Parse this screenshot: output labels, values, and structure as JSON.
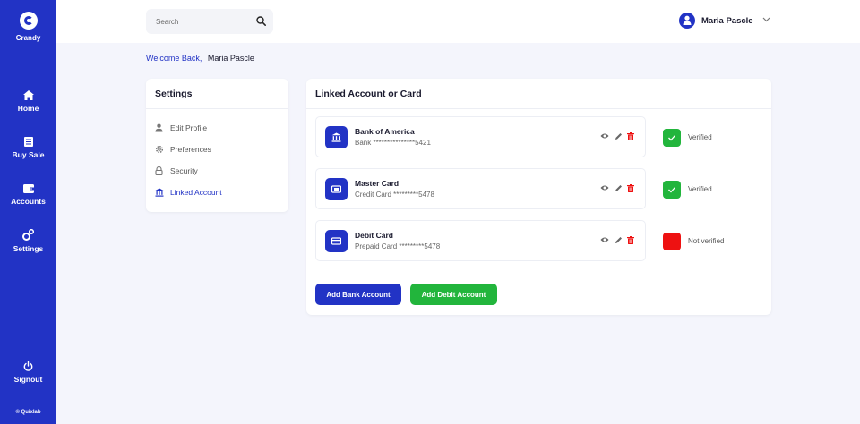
{
  "app": {
    "name": "Crandy",
    "copyright": "© Quixlab"
  },
  "sidebar": {
    "items": [
      {
        "label": "Home",
        "icon": "home-icon"
      },
      {
        "label": "Buy Sale",
        "icon": "receipt-icon"
      },
      {
        "label": "Accounts",
        "icon": "wallet-icon"
      },
      {
        "label": "Settings",
        "icon": "gears-icon"
      }
    ],
    "signout": {
      "label": "Signout",
      "icon": "power-icon"
    }
  },
  "header": {
    "search": {
      "placeholder": "Search",
      "value": ""
    },
    "user": {
      "name": "Maria Pascle"
    }
  },
  "welcome": {
    "greeting": "Welcome Back,",
    "name": "Maria Pascle"
  },
  "settings": {
    "title": "Settings",
    "items": [
      {
        "label": "Edit Profile",
        "icon": "user-icon",
        "active": false
      },
      {
        "label": "Preferences",
        "icon": "gear-icon",
        "active": false
      },
      {
        "label": "Security",
        "icon": "lock-icon",
        "active": false
      },
      {
        "label": "Linked Account",
        "icon": "bank-icon",
        "active": true
      }
    ]
  },
  "linked": {
    "title": "Linked Account or Card",
    "accounts": [
      {
        "name": "Bank of America",
        "detail": "Bank ***************5421",
        "icon": "bank-icon",
        "status": "Verified",
        "verified": true
      },
      {
        "name": "Master Card",
        "detail": "Credit Card *********5478",
        "icon": "card-icon",
        "status": "Verified",
        "verified": true
      },
      {
        "name": "Debit Card",
        "detail": "Prepaid Card *********5478",
        "icon": "card-icon",
        "status": "Not verified",
        "verified": false
      }
    ],
    "buttons": {
      "add_bank": "Add Bank Account",
      "add_debit": "Add Debit Account"
    }
  },
  "colors": {
    "primary": "#2233c5",
    "success": "#22b53c",
    "danger": "#ee1111",
    "background": "#f4f5fc"
  }
}
